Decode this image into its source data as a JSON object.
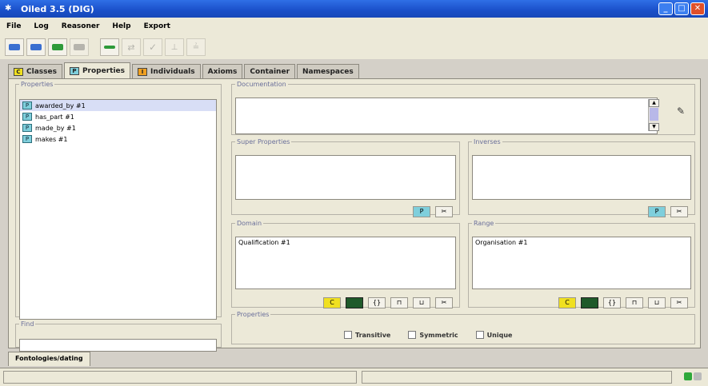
{
  "window": {
    "title": "Oiled 3.5 (DIG)"
  },
  "menu": [
    "File",
    "Log",
    "Reasoner",
    "Help",
    "Export"
  ],
  "toolbar": {
    "buttons": [
      {
        "icon": "open-icon",
        "color": "#3a6fd0"
      },
      {
        "icon": "save-icon",
        "color": "#3a6fd0"
      },
      {
        "icon": "db-green-icon",
        "color": "#2e9a3a"
      },
      {
        "icon": "db-grey-icon",
        "color": "#8a8a8a"
      },
      {
        "icon": "connect-icon",
        "color": "#2e9a3a"
      },
      {
        "icon": "disconnect-icon",
        "color": "#8a8a8a"
      },
      {
        "icon": "check-icon",
        "color": "#8a8a8a"
      },
      {
        "icon": "classify-icon",
        "color": "#8a8a8a"
      },
      {
        "icon": "classify-all-icon",
        "color": "#8a8a8a"
      }
    ]
  },
  "tabs": [
    {
      "label": "Classes",
      "badge": "C",
      "color": "#f0e020"
    },
    {
      "label": "Properties",
      "badge": "P",
      "color": "#7fcfdc"
    },
    {
      "label": "Individuals",
      "badge": "I",
      "color": "#f0a020"
    },
    {
      "label": "Axioms",
      "badge": "",
      "color": ""
    },
    {
      "label": "Container",
      "badge": "",
      "color": ""
    },
    {
      "label": "Namespaces",
      "badge": "",
      "color": ""
    }
  ],
  "properties": {
    "title": "Properties",
    "items": [
      "awarded_by #1",
      "has_part #1",
      "made_by #1",
      "makes #1"
    ]
  },
  "find": {
    "title": "Find",
    "value": ""
  },
  "documentation": {
    "title": "Documentation",
    "value": ""
  },
  "super_properties": {
    "title": "Super Properties"
  },
  "inverses": {
    "title": "Inverses"
  },
  "domain": {
    "title": "Domain",
    "value": "Qualification #1"
  },
  "range": {
    "title": "Range",
    "value": "Organisation #1"
  },
  "prop_flags": {
    "title": "Properties",
    "transitive": "Transitive",
    "symmetric": "Symmetric",
    "unique": "Unique"
  },
  "bottom_tab": "Fontologies/dating"
}
